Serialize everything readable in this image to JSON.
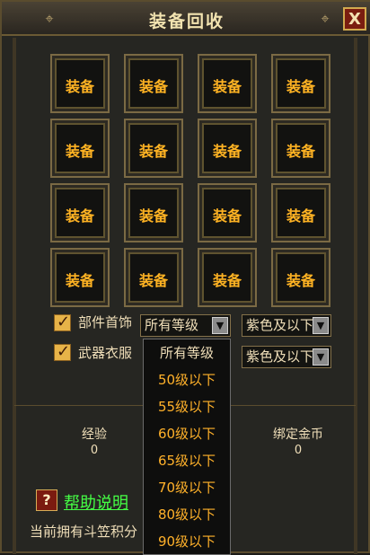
{
  "window": {
    "title": "装备回收",
    "close_label": "X"
  },
  "slots": [
    "装备",
    "装备",
    "装备",
    "装备",
    "装备",
    "装备",
    "装备",
    "装备",
    "装备",
    "装备",
    "装备",
    "装备",
    "装备",
    "装备",
    "装备",
    "装备"
  ],
  "filters": [
    {
      "label": "部件首饰",
      "checked": true,
      "level_value": "所有等级",
      "quality_value": "紫色及以下"
    },
    {
      "label": "武器衣服",
      "checked": true,
      "quality_value": "紫色及以下"
    }
  ],
  "level_menu": {
    "options": [
      "所有等级",
      "50级以下",
      "55级以下",
      "60级以下",
      "65级以下",
      "70级以下",
      "80级以下",
      "90级以下"
    ]
  },
  "stats": {
    "exp_label": "经验",
    "exp_value": "0",
    "gold_label": "绑定金币",
    "gold_value": "0"
  },
  "help": {
    "icon": "?",
    "text": "帮助说明"
  },
  "footer": {
    "points_text": "当前拥有斗笠积分"
  }
}
